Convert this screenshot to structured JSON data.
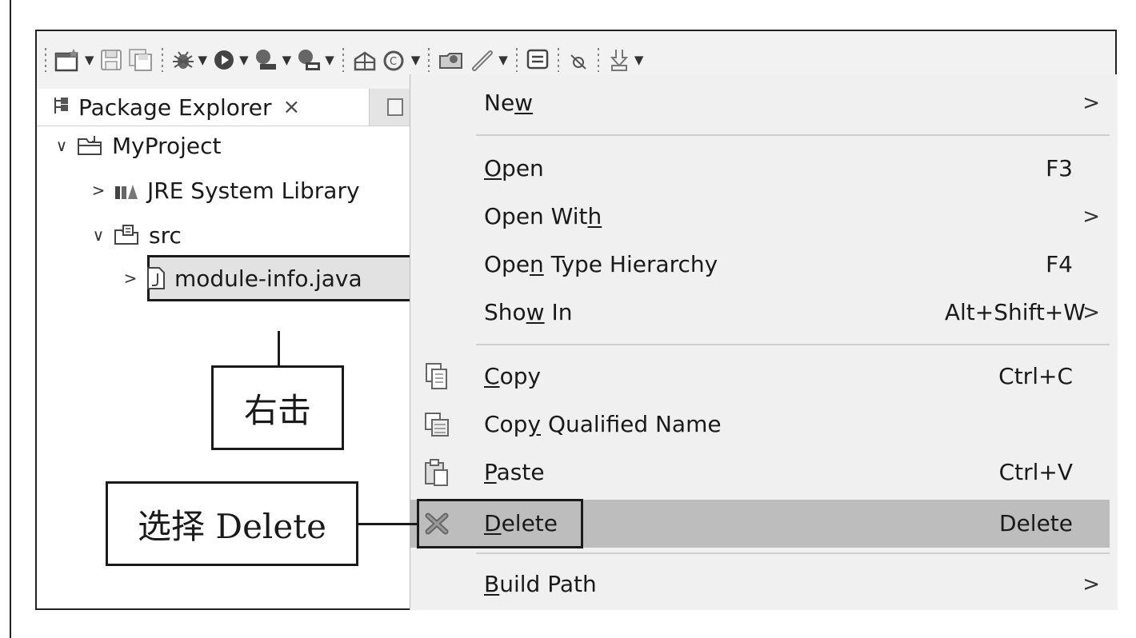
{
  "explorer": {
    "tab_label": "Package Explorer",
    "tab_close": "×",
    "tree": [
      {
        "label": "MyProject",
        "twisty": "∨"
      },
      {
        "label": "JRE System Library",
        "twisty": ">"
      },
      {
        "label": "src",
        "twisty": "∨"
      },
      {
        "label": "module-info.java",
        "twisty": ">"
      }
    ]
  },
  "context_menu": {
    "items": [
      {
        "before": "Ne",
        "key": "w",
        "after": "",
        "shortcut": "",
        "submenu": ">"
      },
      {
        "before": "",
        "key": "O",
        "after": "pen",
        "shortcut": "F3",
        "submenu": ""
      },
      {
        "before": "Open Wit",
        "key": "h",
        "after": "",
        "shortcut": "",
        "submenu": ">"
      },
      {
        "before": "Ope",
        "key": "n",
        "after": " Type Hierarchy",
        "shortcut": "F4",
        "submenu": ""
      },
      {
        "before": "Sho",
        "key": "w",
        "after": " In",
        "shortcut": "Alt+Shift+W",
        "submenu": ">"
      },
      {
        "before": "",
        "key": "C",
        "after": "opy",
        "shortcut": "Ctrl+C",
        "submenu": ""
      },
      {
        "before": "Cop",
        "key": "y",
        "after": " Qualified Name",
        "shortcut": "",
        "submenu": ""
      },
      {
        "before": "",
        "key": "P",
        "after": "aste",
        "shortcut": "Ctrl+V",
        "submenu": ""
      },
      {
        "before": "",
        "key": "D",
        "after": "elete",
        "shortcut": "Delete",
        "submenu": ""
      },
      {
        "before": "",
        "key": "B",
        "after": "uild Path",
        "shortcut": "",
        "submenu": ">"
      }
    ]
  },
  "callouts": {
    "right_click": "右击",
    "select_delete": "选择 Delete"
  },
  "toolbar": {
    "icons": [
      "new-wizard-icon",
      "save-icon",
      "save-all-icon",
      "debug-icon",
      "run-icon",
      "run-tool-icon",
      "coverage-icon",
      "new-package-icon",
      "new-class-icon",
      "open-type-icon",
      "search-icon",
      "task-icon",
      "skip-breakpoints-icon",
      "next-annotation-icon"
    ]
  }
}
